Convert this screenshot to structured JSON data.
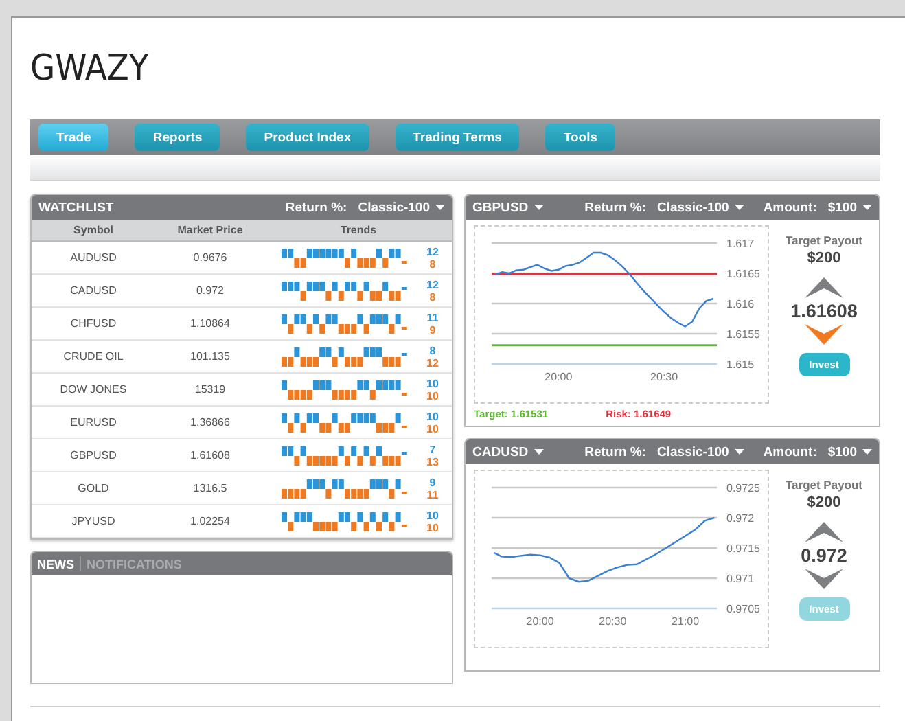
{
  "page_title": "GWAZY",
  "nav": [
    {
      "label": "Trade",
      "selected": true
    },
    {
      "label": "Reports",
      "selected": false
    },
    {
      "label": "Product Index",
      "selected": false
    },
    {
      "label": "Trading Terms",
      "selected": false
    },
    {
      "label": "Tools",
      "selected": false
    }
  ],
  "watchlist": {
    "title": "WATCHLIST",
    "return_label": "Return %:",
    "return_value": "Classic-100",
    "columns": [
      "Symbol",
      "Market Price",
      "Trends"
    ],
    "rows": [
      {
        "symbol": "AUDUSD",
        "price": "0.9676",
        "trend_up": [
          true,
          true,
          false,
          false,
          true,
          true,
          true,
          true,
          true,
          true,
          false,
          true,
          false,
          false,
          false,
          true,
          false,
          true,
          true,
          false
        ],
        "up_count": "12",
        "down_count": "8"
      },
      {
        "symbol": "CADUSD",
        "price": "0.972",
        "trend_up": [
          true,
          true,
          true,
          false,
          true,
          true,
          true,
          false,
          true,
          false,
          true,
          true,
          false,
          true,
          false,
          false,
          true,
          false,
          false,
          true
        ],
        "up_count": "12",
        "down_count": "8"
      },
      {
        "symbol": "CHFUSD",
        "price": "1.10864",
        "trend_up": [
          true,
          false,
          true,
          true,
          false,
          true,
          false,
          true,
          true,
          false,
          false,
          false,
          true,
          false,
          true,
          true,
          true,
          false,
          true,
          false
        ],
        "up_count": "11",
        "down_count": "9"
      },
      {
        "symbol": "CRUDE OIL",
        "price": "101.135",
        "trend_up": [
          false,
          false,
          true,
          false,
          false,
          false,
          true,
          true,
          false,
          true,
          false,
          false,
          false,
          true,
          true,
          true,
          false,
          false,
          false,
          true
        ],
        "up_count": "8",
        "down_count": "12"
      },
      {
        "symbol": "DOW JONES",
        "price": "15319",
        "trend_up": [
          true,
          false,
          false,
          false,
          false,
          true,
          true,
          true,
          false,
          false,
          false,
          false,
          true,
          true,
          false,
          true,
          true,
          true,
          true,
          false
        ],
        "up_count": "10",
        "down_count": "10"
      },
      {
        "symbol": "EURUSD",
        "price": "1.36866",
        "trend_up": [
          true,
          false,
          true,
          false,
          true,
          true,
          false,
          false,
          true,
          false,
          false,
          true,
          true,
          true,
          true,
          false,
          false,
          false,
          true,
          false
        ],
        "up_count": "10",
        "down_count": "10"
      },
      {
        "symbol": "GBPUSD",
        "price": "1.61608",
        "trend_up": [
          true,
          true,
          false,
          true,
          false,
          false,
          false,
          false,
          false,
          true,
          false,
          true,
          false,
          true,
          false,
          true,
          false,
          false,
          false,
          true
        ],
        "up_count": "7",
        "down_count": "13"
      },
      {
        "symbol": "GOLD",
        "price": "1316.5",
        "trend_up": [
          false,
          false,
          false,
          false,
          true,
          true,
          true,
          false,
          true,
          true,
          false,
          false,
          false,
          false,
          true,
          true,
          true,
          false,
          true,
          false
        ],
        "up_count": "9",
        "down_count": "11"
      },
      {
        "symbol": "JPYUSD",
        "price": "1.02254",
        "trend_up": [
          true,
          false,
          true,
          true,
          true,
          false,
          false,
          false,
          false,
          true,
          true,
          false,
          true,
          false,
          true,
          false,
          true,
          false,
          true,
          false
        ],
        "up_count": "10",
        "down_count": "10"
      }
    ]
  },
  "news": {
    "tabs": [
      {
        "label": "NEWS",
        "selected": true
      },
      {
        "label": "NOTIFICATIONS",
        "selected": false
      }
    ]
  },
  "trade_panels": [
    {
      "symbol": "GBPUSD",
      "return_label": "Return %:",
      "return_value": "Classic-100",
      "amount_label": "Amount:",
      "amount_value": "$100",
      "payout_label": "Target Payout",
      "payout": "$200",
      "price": "1.61608",
      "up_selected": false,
      "down_selected": true,
      "invest": {
        "label": "Invest",
        "disabled": false
      },
      "target_label": "Target: 1.61531",
      "risk_label": "Risk: 1.61649",
      "chart_data": {
        "type": "line",
        "x": [
          1182,
          1184,
          1186,
          1188,
          1190,
          1192,
          1194,
          1196,
          1198,
          1200,
          1202,
          1204,
          1206,
          1208,
          1210,
          1212,
          1214,
          1216,
          1218,
          1220,
          1222,
          1224,
          1226,
          1228,
          1230,
          1232,
          1234,
          1236,
          1238,
          1240,
          1242,
          1244
        ],
        "series": [
          {
            "color": "#3a7fd0",
            "values": [
              1.61648,
              1.61652,
              1.6165,
              1.61655,
              1.61656,
              1.6166,
              1.61664,
              1.61658,
              1.61654,
              1.61656,
              1.61662,
              1.61664,
              1.61668,
              1.61676,
              1.61684,
              1.61684,
              1.6168,
              1.61672,
              1.61662,
              1.6165,
              1.61636,
              1.61622,
              1.6161,
              1.61598,
              1.61586,
              1.61576,
              1.61568,
              1.61562,
              1.6157,
              1.61592,
              1.61604,
              1.61608
            ]
          }
        ],
        "xlim": [
          1181,
          1245
        ],
        "ylim": [
          1.615,
          1.617
        ],
        "xticks": [
          {
            "value": 1200,
            "label": "20:00"
          },
          {
            "value": 1230,
            "label": "20:30"
          }
        ],
        "yticks": [
          1.615,
          1.6155,
          1.616,
          1.6165,
          1.617
        ],
        "grid": true,
        "ref_lines": [
          {
            "axis": "y",
            "value": 1.61649,
            "color": "#e8303d"
          },
          {
            "axis": "y",
            "value": 1.61531,
            "color": "#5cb82e"
          }
        ]
      }
    },
    {
      "symbol": "CADUSD",
      "return_label": "Return %:",
      "return_value": "Classic-100",
      "amount_label": "Amount:",
      "amount_value": "$100",
      "payout_label": "Target Payout",
      "payout": "$200",
      "price": "0.972",
      "up_selected": false,
      "down_selected": false,
      "invest": {
        "label": "Invest",
        "disabled": true
      },
      "chart_data": {
        "type": "line",
        "x": [
          1181,
          1184,
          1188,
          1192,
          1196,
          1200,
          1204,
          1208,
          1212,
          1216,
          1220,
          1224,
          1228,
          1232,
          1236,
          1240,
          1248,
          1256,
          1264,
          1268,
          1272
        ],
        "series": [
          {
            "color": "#3a7fd0",
            "values": [
              0.97142,
              0.97136,
              0.97135,
              0.97137,
              0.97139,
              0.97138,
              0.97134,
              0.97125,
              0.971,
              0.97094,
              0.97096,
              0.97104,
              0.97112,
              0.97118,
              0.97122,
              0.97123,
              0.9714,
              0.9716,
              0.9718,
              0.97195,
              0.972
            ]
          }
        ],
        "xlim": [
          1180,
          1273
        ],
        "ylim": [
          0.9705,
          0.9725
        ],
        "xticks": [
          {
            "value": 1200,
            "label": "20:00"
          },
          {
            "value": 1230,
            "label": "20:30"
          },
          {
            "value": 1260,
            "label": "21:00"
          }
        ],
        "yticks": [
          0.9705,
          0.971,
          0.9715,
          0.972,
          0.9725
        ],
        "grid": true
      }
    }
  ]
}
